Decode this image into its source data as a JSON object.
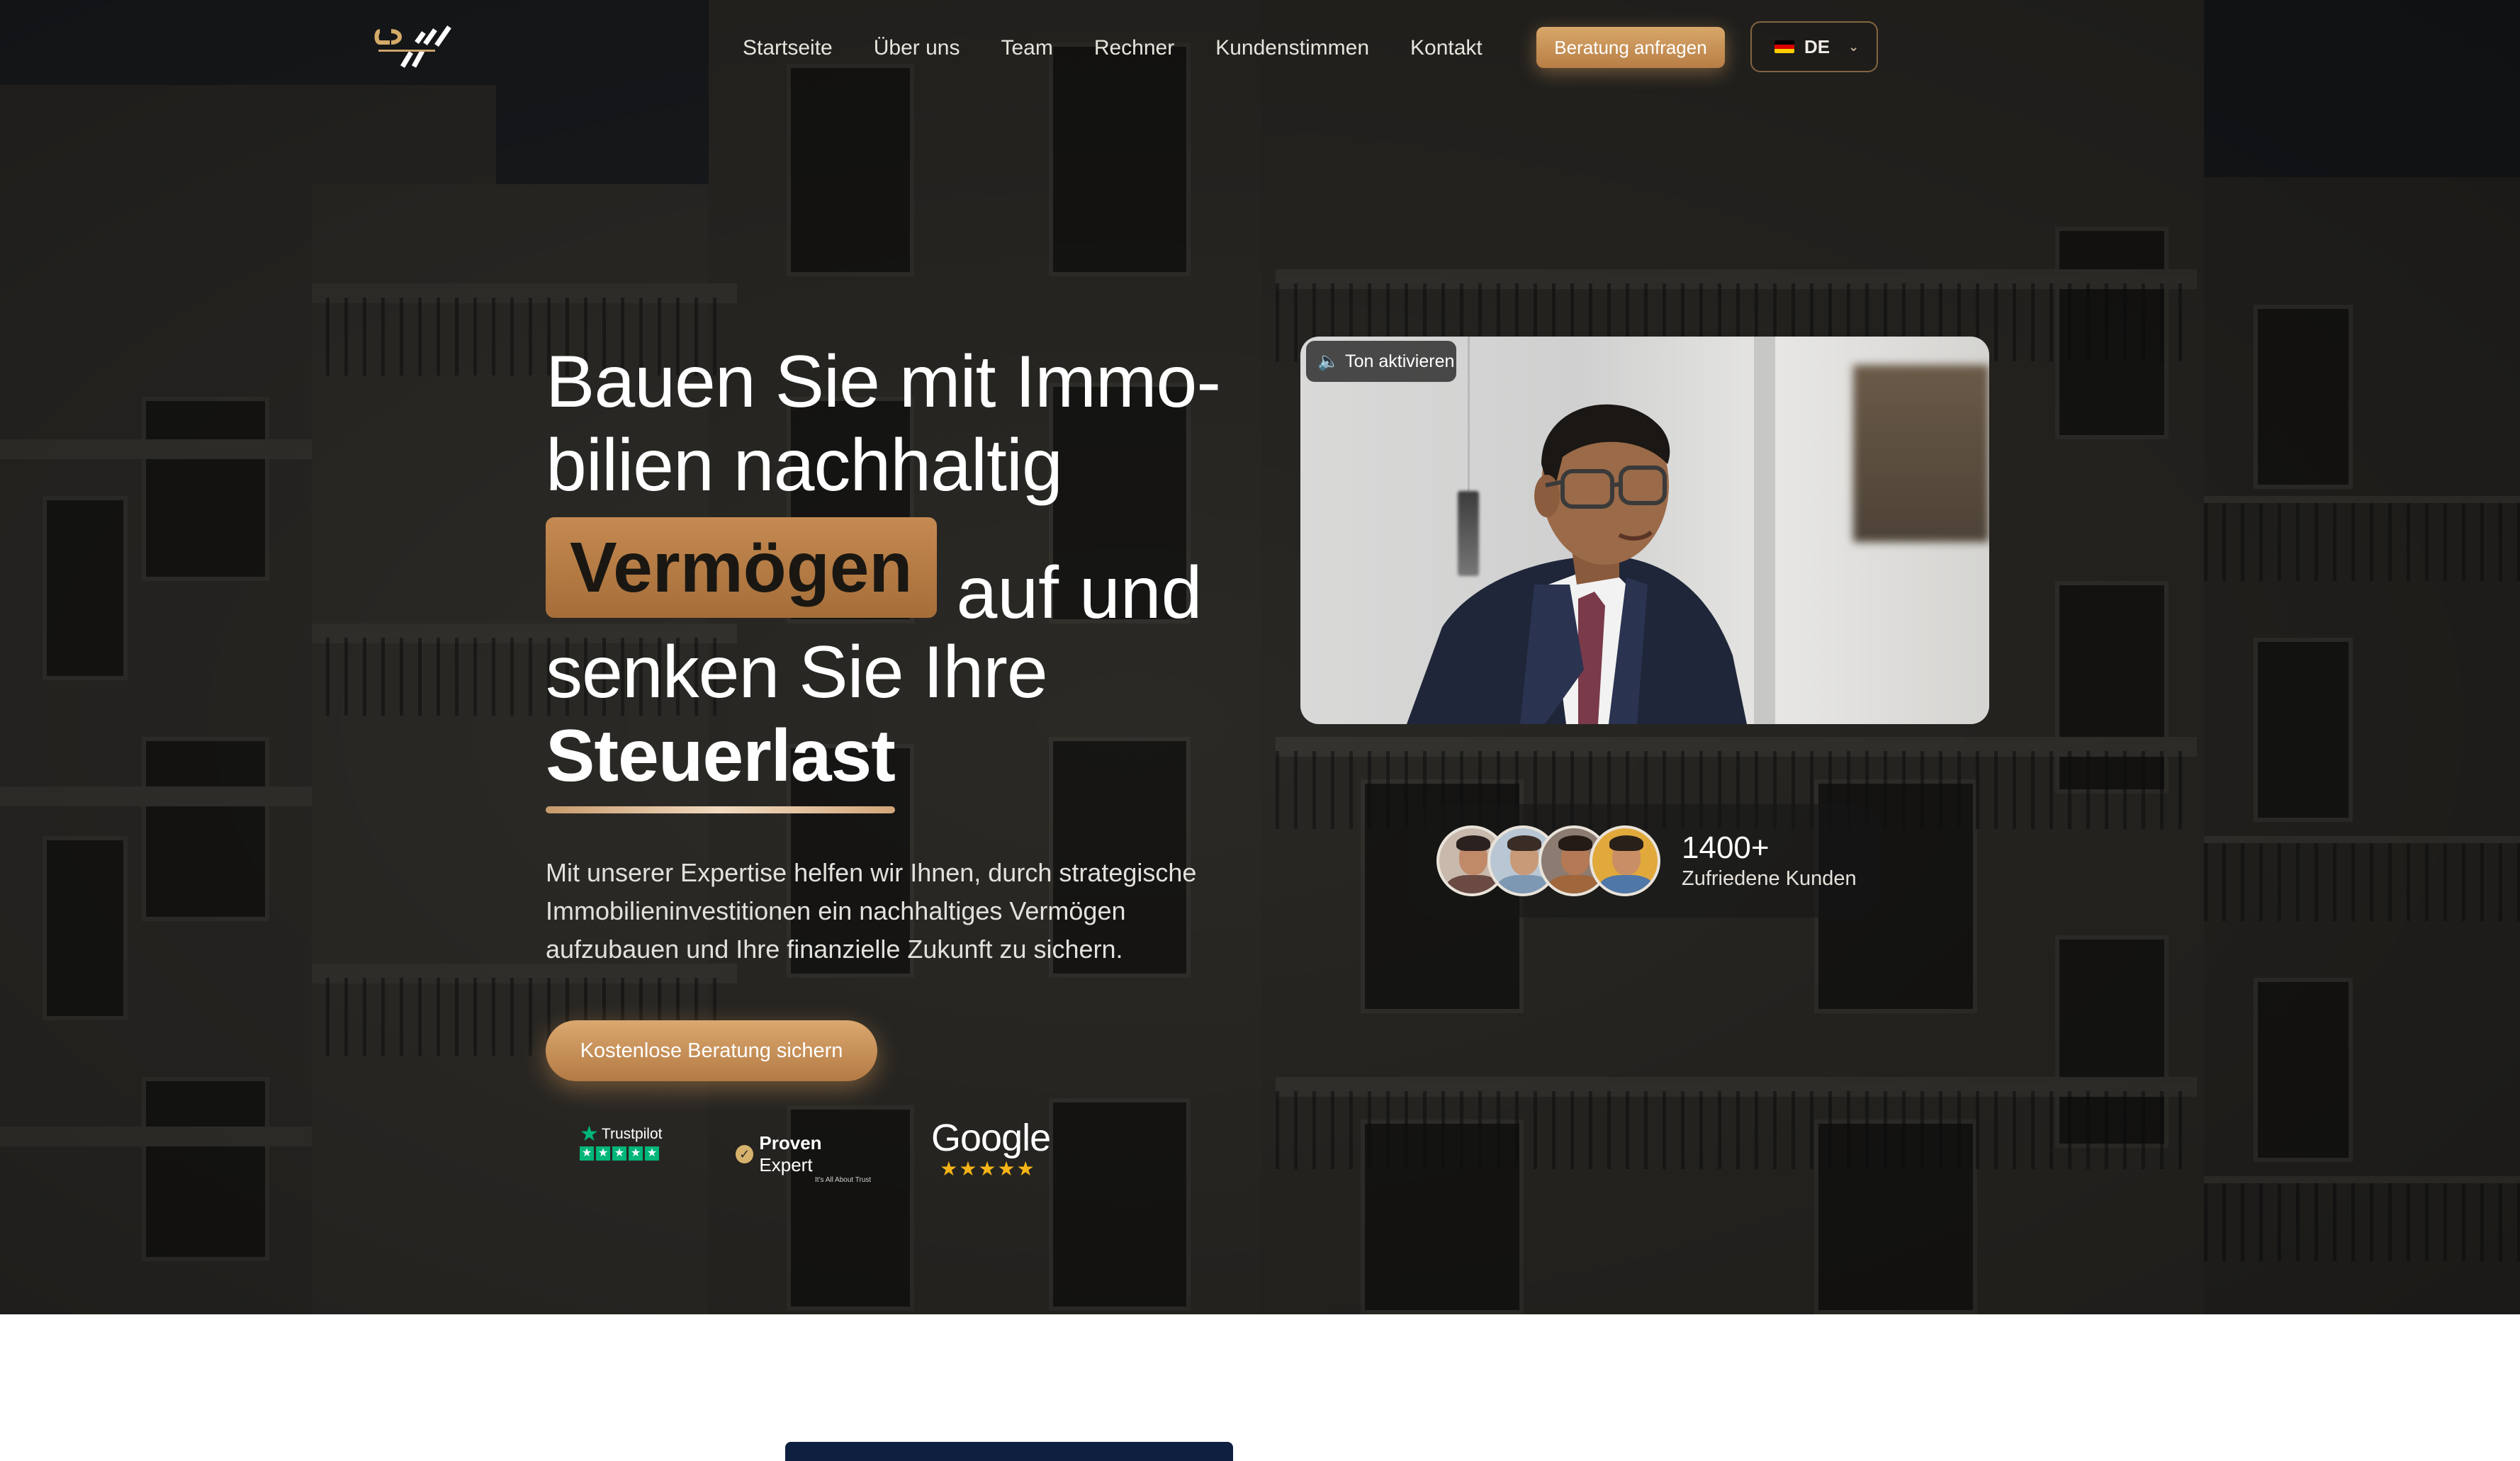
{
  "brand": {
    "logo_name": "company-logo",
    "accent": "#c58a52"
  },
  "nav": {
    "items": [
      {
        "label": "Startseite"
      },
      {
        "label": "Über uns"
      },
      {
        "label": "Team"
      },
      {
        "label": "Rechner"
      },
      {
        "label": "Kundenstimmen"
      },
      {
        "label": "Kontakt"
      }
    ],
    "cta_label": "Beratung anfragen",
    "language": {
      "code": "DE",
      "flag": "germany-flag-icon"
    }
  },
  "hero": {
    "line1": "Bauen Sie mit Immo-",
    "line2": "bilien nachhaltig",
    "highlight": "Vermögen",
    "line3_rest": "auf und",
    "line4": "senken Sie Ihre",
    "line5_bold": "Steuerlast",
    "subtitle": "Mit unserer Expertise helfen wir Ihnen, durch strategische Immobilieninvestitionen ein nachhaltiges Vermögen aufzubauen und Ihre finanzielle Zukunft zu sichern.",
    "cta_label": "Kostenlose Beratung sichern"
  },
  "reviews": {
    "trustpilot": {
      "name": "Trustpilot",
      "stars": 5
    },
    "provenexpert": {
      "name_bold": "Proven",
      "name_regular": "Expert",
      "tagline": "It's All About Trust"
    },
    "google": {
      "name": "Google",
      "stars": 5
    }
  },
  "video": {
    "sound_button": "Ton aktivieren",
    "sound_icon": "speaker-icon"
  },
  "customers": {
    "count": "1400+",
    "label": "Zufriedene Kunden",
    "avatars": 4
  }
}
